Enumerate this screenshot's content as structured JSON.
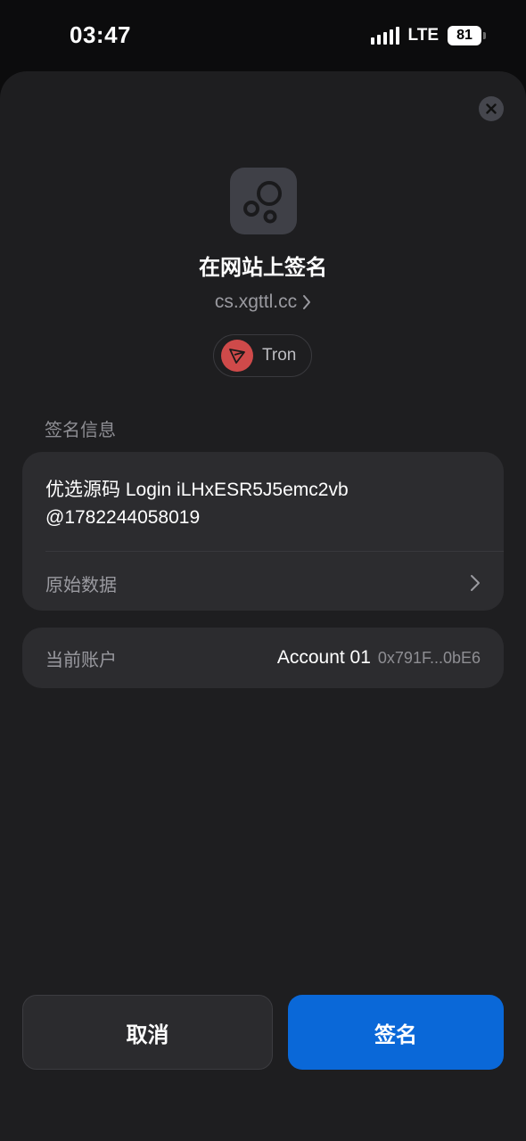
{
  "status_bar": {
    "time": "03:47",
    "network": "LTE",
    "battery": "81"
  },
  "sheet": {
    "close_icon": "close-icon",
    "dapp_icon": "bubbles-logo-icon",
    "title": "在网站上签名",
    "site": "cs.xgttl.cc",
    "chain": {
      "name": "Tron",
      "icon": "tron-logo-icon",
      "color": "#cf4a4a"
    },
    "message_section_label": "签名信息",
    "message_line1": "优选源码 Login iLHxESR5J5emc2vb",
    "message_line2": "@1782244058019",
    "raw_data_label": "原始数据",
    "account_label": "当前账户",
    "account_name": "Account 01",
    "account_address": "0x791F...0bE6"
  },
  "buttons": {
    "cancel": "取消",
    "sign": "签名"
  },
  "colors": {
    "background": "#1e1e20",
    "card": "#2c2c2f",
    "accent": "#0a68d8"
  }
}
